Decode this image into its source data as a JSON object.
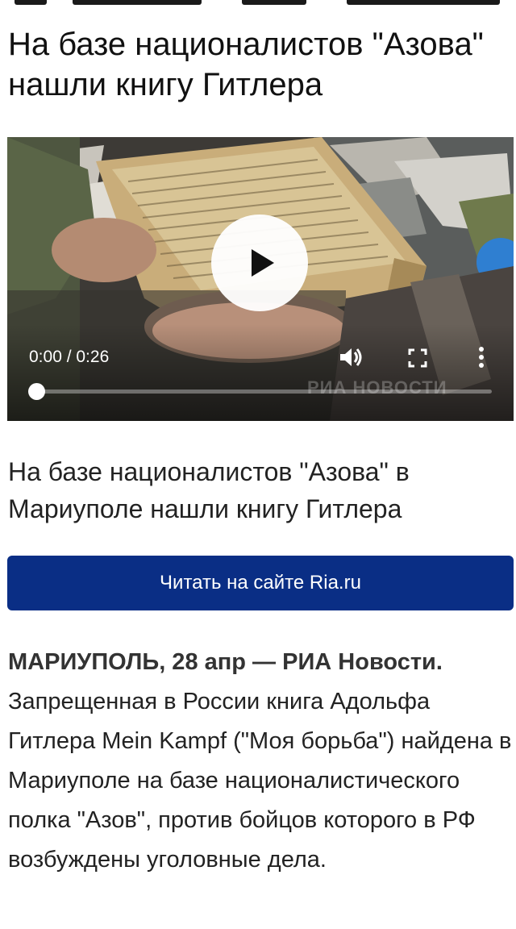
{
  "article": {
    "title": "На базе националистов \"Азова\" нашли книгу Гитлера",
    "caption": "На базе националистов \"Азова\" в Мариуполе нашли книгу Гитлера",
    "cta_label": "Читать на сайте Ria.ru",
    "dateline": "МАРИУПОЛЬ, 28 апр — РИА Новости.",
    "body": "Запрещенная в России книга Адольфа Гитлера Mein Kampf (\"Моя борьба\") найдена в Мариуполе на базе националистического полка \"Азов\", против бойцов которого в РФ возбуждены уголовные дела."
  },
  "video": {
    "time_display": "0:00 / 0:26",
    "progress": 0,
    "watermark": "РИА НОВОСТИ",
    "icons": [
      "play-icon",
      "volume-icon",
      "fullscreen-icon",
      "more-vert-icon"
    ]
  },
  "colors": {
    "cta_background": "#0a2e85",
    "background": "#ffffff"
  }
}
